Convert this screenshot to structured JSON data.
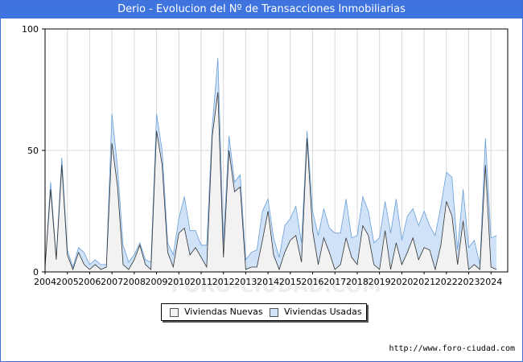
{
  "title": "Derio - Evolucion del Nº de Transacciones Inmobiliarias",
  "source": "http://www.foro-ciudad.com",
  "watermark": "FORO-CIUDAD.COM",
  "chart_data": {
    "type": "area",
    "title": "Derio - Evolucion del Nº de Transacciones Inmobiliarias",
    "xlabel": "",
    "ylabel": "",
    "ylim": [
      0,
      100
    ],
    "xlim": [
      2004,
      2024.75
    ],
    "y_ticks": [
      0,
      50,
      100
    ],
    "x_ticks": [
      "2004",
      "2005",
      "2006",
      "2007",
      "2008",
      "2009",
      "2010",
      "2011",
      "2012",
      "2013",
      "2014",
      "2015",
      "2016",
      "2017",
      "2018",
      "2019",
      "2020",
      "2021",
      "2022",
      "2023",
      "2024"
    ],
    "grid": true,
    "legend": "bottom-center",
    "stacked": true,
    "x_start_year": 2004,
    "period": "quarter",
    "series": [
      {
        "name": "Viviendas Nuevas",
        "color": "#f2f2f2",
        "values": [
          2,
          34,
          5,
          44,
          7,
          1,
          8,
          3,
          1,
          3,
          1,
          2,
          53,
          35,
          3,
          1,
          5,
          11,
          3,
          1,
          58,
          44,
          8,
          2,
          16,
          18,
          7,
          10,
          6,
          2,
          56,
          74,
          6,
          50,
          33,
          35,
          1,
          2,
          2,
          13,
          25,
          7,
          1,
          8,
          13,
          15,
          4,
          55,
          17,
          3,
          14,
          8,
          1,
          3,
          14,
          6,
          3,
          19,
          15,
          3,
          1,
          17,
          1,
          12,
          3,
          8,
          14,
          5,
          10,
          9,
          1,
          11,
          29,
          23,
          3,
          21,
          1,
          3,
          1,
          44,
          2,
          1
        ]
      },
      {
        "name": "Viviendas Usadas",
        "color": "#cfe2f7",
        "values": [
          0,
          3,
          1,
          3,
          2,
          1,
          2,
          5,
          2,
          2,
          2,
          1,
          12,
          8,
          8,
          3,
          2,
          1,
          2,
          3,
          7,
          6,
          4,
          5,
          6,
          13,
          10,
          7,
          5,
          9,
          4,
          14,
          6,
          6,
          4,
          5,
          4,
          6,
          7,
          12,
          5,
          7,
          5,
          11,
          9,
          12,
          8,
          3,
          8,
          12,
          12,
          10,
          15,
          13,
          16,
          8,
          12,
          12,
          10,
          9,
          13,
          12,
          15,
          18,
          10,
          15,
          12,
          14,
          15,
          10,
          14,
          16,
          12,
          16,
          6,
          13,
          9,
          10,
          2,
          11,
          12,
          14
        ]
      }
    ]
  }
}
